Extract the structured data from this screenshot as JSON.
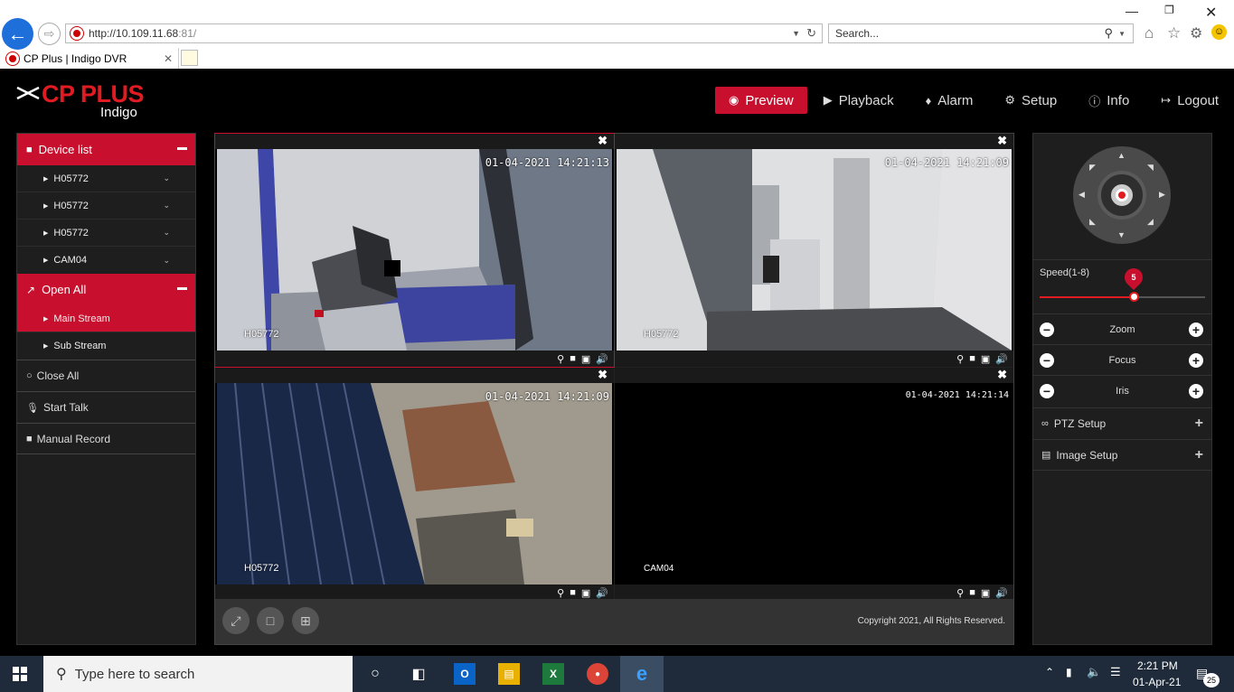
{
  "browser": {
    "url_host": "http://10.109.11.68",
    "url_port": ":81/",
    "search_placeholder": "Search...",
    "tab_title": "CP Plus | Indigo DVR"
  },
  "app": {
    "brand": "CP PLUS",
    "brand_sub": "Indigo",
    "nav": [
      {
        "label": "Preview",
        "icon": "eye-icon",
        "active": true
      },
      {
        "label": "Playback",
        "icon": "play-circle-icon"
      },
      {
        "label": "Alarm",
        "icon": "bell-icon"
      },
      {
        "label": "Setup",
        "icon": "gear-icon"
      },
      {
        "label": "Info",
        "icon": "info-icon"
      },
      {
        "label": "Logout",
        "icon": "logout-icon"
      }
    ]
  },
  "left": {
    "device_list": "Device list",
    "devices": [
      "H05772",
      "H05772",
      "H05772",
      "CAM04"
    ],
    "open_all": "Open All",
    "main_stream": "Main Stream",
    "sub_stream": "Sub Stream",
    "close_all": "Close All",
    "start_talk": "Start Talk",
    "manual_record": "Manual Record"
  },
  "cameras": [
    {
      "timestamp": "01-04-2021 14:21:13",
      "label": "H05772"
    },
    {
      "timestamp": "01-04-2021 14:21:09",
      "label": "H05772"
    },
    {
      "timestamp": "01-04-2021 14:21:09",
      "label": "H05772"
    },
    {
      "timestamp": "01-04-2021 14:21:14",
      "label": "CAM04"
    }
  ],
  "grid": {
    "copyright": "Copyright 2021, All Rights Reserved."
  },
  "right": {
    "speed_label": "Speed(1-8)",
    "speed_value": "5",
    "speed_fraction": 0.57,
    "zoom": "Zoom",
    "focus": "Focus",
    "iris": "Iris",
    "ptz_setup": "PTZ Setup",
    "image_setup": "Image Setup"
  },
  "taskbar": {
    "search_placeholder": "Type here to search",
    "time": "2:21 PM",
    "date": "01-Apr-21",
    "notifications": "25"
  },
  "colors": {
    "accent": "#c8102e",
    "brand": "#e01b22"
  }
}
